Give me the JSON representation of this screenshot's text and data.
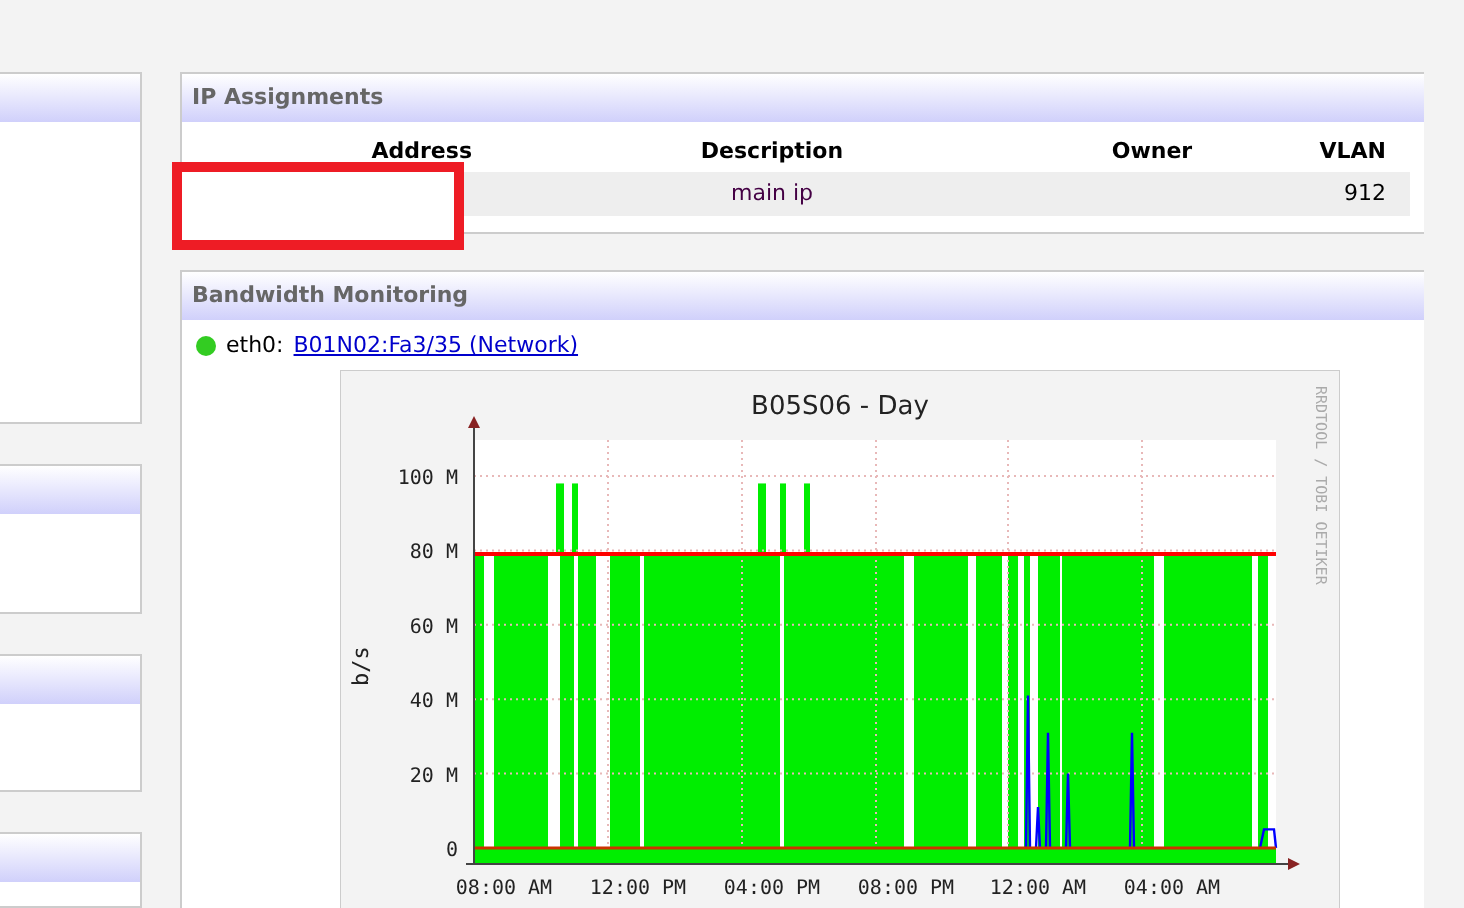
{
  "ip_assignments": {
    "title": "IP Assignments",
    "columns": [
      "Address",
      "Description",
      "Owner",
      "VLAN"
    ],
    "rows": [
      {
        "description": "main ip",
        "vlan": "912"
      }
    ]
  },
  "bandwidth_monitoring": {
    "title": "Bandwidth Monitoring",
    "interfaces": [
      {
        "color": "#33cc22",
        "name": "eth0:",
        "link": "B01N02:Fa3/35 (Network)",
        "graph": {
          "title": "B05S06  -  Day",
          "ylabel": "b/s",
          "side_label": "RRDTOOL / TOBI OETIKER",
          "yticks": [
            "100 M",
            "80 M",
            "60 M",
            "40 M",
            "20 M",
            "0"
          ],
          "xticks": [
            "08:00 AM",
            "12:00 PM",
            "04:00 PM",
            "08:00 PM",
            "12:00 AM",
            "04:00 AM"
          ]
        }
      }
    ]
  }
}
